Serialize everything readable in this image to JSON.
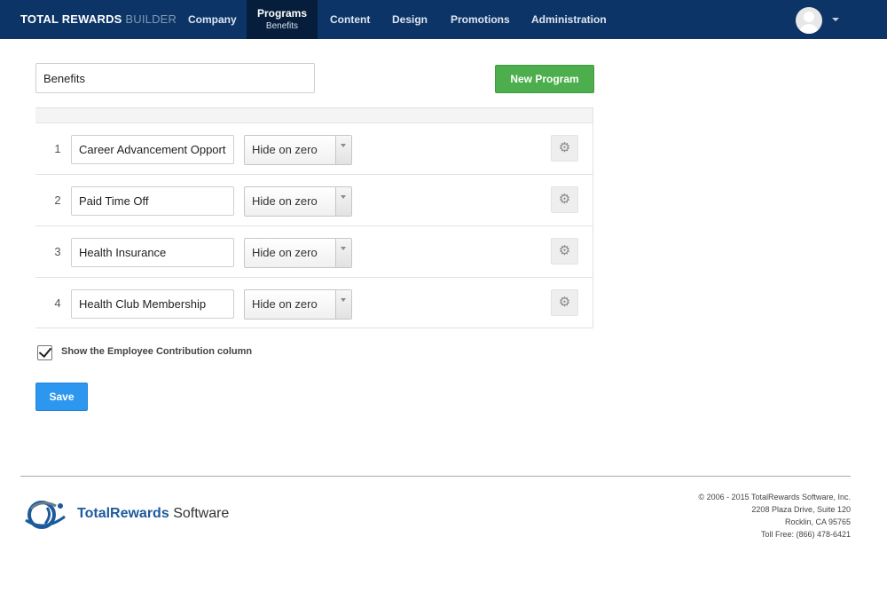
{
  "header": {
    "brand_primary": "TOTAL REWARDS",
    "brand_secondary": "BUILDER",
    "nav": {
      "company": "Company",
      "programs": "Programs",
      "programs_sub": "Benefits",
      "content": "Content",
      "design": "Design",
      "promotions": "Promotions",
      "administration": "Administration"
    },
    "user_icon": "avatar-icon",
    "menu_icon": "caret-down-icon"
  },
  "program": {
    "name_value": "Benefits",
    "new_program_label": "New Program"
  },
  "items": [
    {
      "number": "1",
      "name": "Career Advancement Opportunities",
      "display": "Hide on zero"
    },
    {
      "number": "2",
      "name": "Paid Time Off",
      "display": "Hide on zero"
    },
    {
      "number": "3",
      "name": "Health Insurance",
      "display": "Hide on zero"
    },
    {
      "number": "4",
      "name": "Health Club Membership",
      "display": "Hide on zero"
    }
  ],
  "options": {
    "show_contribution_label": "Show the Employee Contribution column",
    "show_contribution_checked": true
  },
  "actions": {
    "save_label": "Save"
  },
  "footer": {
    "logo_text_primary": "TotalRewards",
    "logo_text_secondary": "Software",
    "copyright": "© 2006 - 2015 TotalRewards Software, Inc.",
    "address_line1": "2208 Plaza Drive, Suite 120",
    "address_line2": "Rocklin, CA 95765",
    "phone": "Toll Free: (866) 478-6421"
  },
  "colors": {
    "navbar": "#0d3466",
    "navbar_active": "#061e3c",
    "primary_button": "#2d97f0",
    "success_button": "#4cae4c"
  }
}
